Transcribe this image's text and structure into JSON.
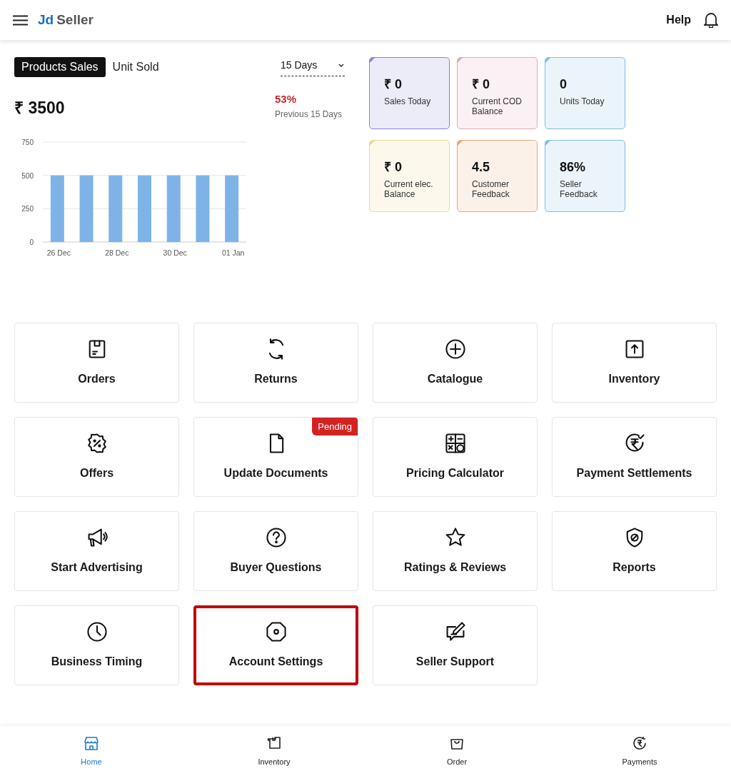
{
  "header": {
    "logo_first": "Jd",
    "logo_second": "Seller",
    "help": "Help"
  },
  "sales": {
    "tabs": [
      {
        "label": "Products Sales",
        "selected": true
      },
      {
        "label": "Unit Sold",
        "selected": false
      }
    ],
    "period": "15 Days",
    "total": "₹ 3500",
    "change": "53%",
    "change_label": "Previous 15 Days",
    "chart_data": {
      "type": "bar",
      "values": [
        500,
        500,
        500,
        500,
        500,
        500,
        500
      ],
      "ylim": [
        0,
        750
      ],
      "yticks": [
        0,
        250,
        500,
        750
      ],
      "categories": [
        "26 Dec",
        null,
        "28 Dec",
        null,
        "30 Dec",
        null,
        "01 Jan"
      ]
    }
  },
  "stats": [
    {
      "value": "₹ 0",
      "label": "Sales Today",
      "color": "#8b84d7"
    },
    {
      "value": "₹ 0",
      "label": "Current COD Balance",
      "color": "#e9a5b8"
    },
    {
      "value": "0",
      "label": "Units Today",
      "color": "#7fbfe0"
    },
    {
      "value": "₹ 0",
      "label": "Current elec. Balance",
      "color": "#eadb8a"
    },
    {
      "value": "4.5",
      "label": "Customer Feedback",
      "color": "#e8a878"
    },
    {
      "value": "86%",
      "label": "Seller Feedback",
      "color": "#7fbfe0"
    }
  ],
  "tiles": [
    {
      "label": "Orders",
      "highlighted": false
    },
    {
      "label": "Returns",
      "highlighted": false
    },
    {
      "label": "Catalogue",
      "highlighted": false
    },
    {
      "label": "Inventory",
      "highlighted": false
    },
    {
      "label": "Offers",
      "highlighted": false
    },
    {
      "label": "Update Documents",
      "badge": "Pending",
      "highlighted": false
    },
    {
      "label": "Pricing Calculator",
      "highlighted": false
    },
    {
      "label": "Payment Settlements",
      "highlighted": false
    },
    {
      "label": "Start Advertising",
      "highlighted": false
    },
    {
      "label": "Buyer Questions",
      "highlighted": false
    },
    {
      "label": "Ratings & Reviews",
      "highlighted": false
    },
    {
      "label": "Reports",
      "highlighted": false
    },
    {
      "label": "Business Timing",
      "highlighted": false
    },
    {
      "label": "Account Settings",
      "highlighted": true
    },
    {
      "label": "Seller Support",
      "highlighted": false
    }
  ],
  "bottom_nav": [
    {
      "label": "Home",
      "selected": true
    },
    {
      "label": "Inventory",
      "selected": false
    },
    {
      "label": "Order",
      "selected": false
    },
    {
      "label": "Payments",
      "selected": false
    }
  ]
}
